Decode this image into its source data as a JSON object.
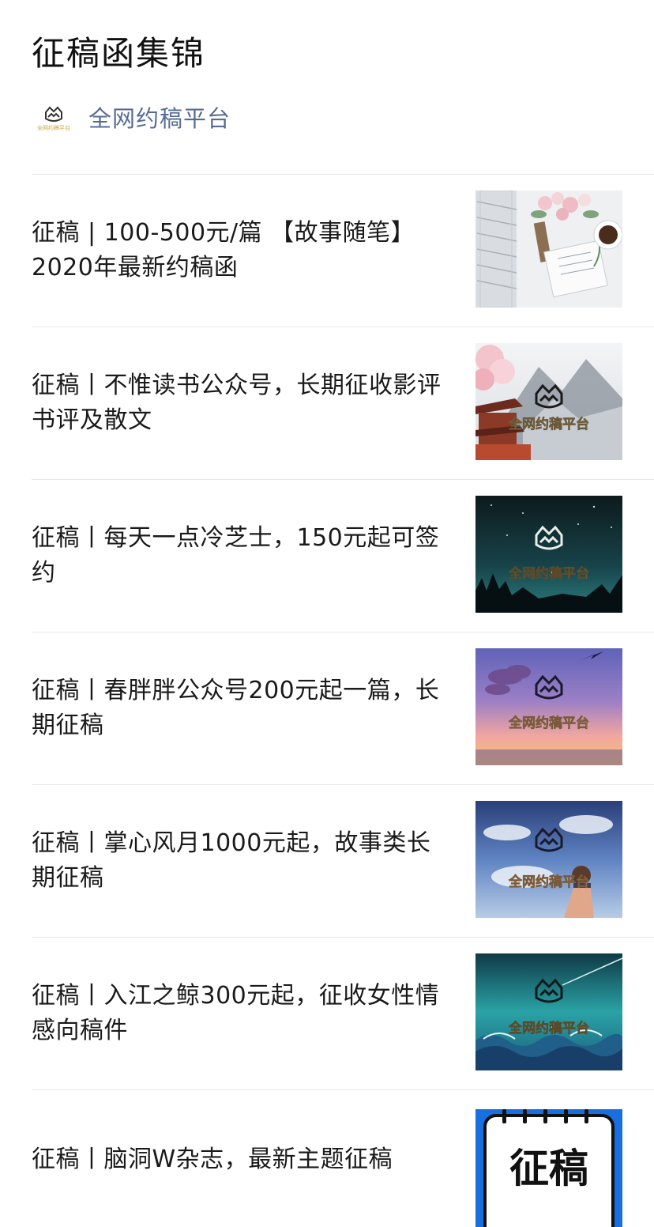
{
  "page": {
    "title": "征稿函集锦"
  },
  "account": {
    "name": "全网约稿平台",
    "logo_text": "全网约稿平台",
    "logo_icon": "crown-mountain-logo"
  },
  "articles": [
    {
      "title": "征稿 | 100-500元/篇 【故事随笔】2020年最新约稿函",
      "thumbnail": "books-flowers-coffee-photo"
    },
    {
      "title": "征稿丨不惟读书公众号，长期征收影评书评及散文",
      "thumbnail": "pavilion-mountain-painting",
      "overlay_text": "全网约稿平台"
    },
    {
      "title": "征稿丨每天一点冷芝士，150元起可签约",
      "thumbnail": "night-sky-forest",
      "overlay_text": "全网约稿平台"
    },
    {
      "title": "征稿丨春胖胖公众号200元起一篇，长期征稿",
      "thumbnail": "sunset-sky-purple",
      "overlay_text": "全网约稿平台"
    },
    {
      "title": "征稿丨掌心风月1000元起，故事类长期征稿",
      "thumbnail": "anime-girl-sky",
      "overlay_text": "全网约稿平台"
    },
    {
      "title": "征稿丨入江之鲸300元起，征收女性情感向稿件",
      "thumbnail": "teal-ocean-waves",
      "overlay_text": "全网约稿平台"
    },
    {
      "title": "征稿丨脑洞W杂志，最新主题征稿",
      "thumbnail": "calendar-zhenggao-icon",
      "overlay_text": "征稿"
    }
  ],
  "colors": {
    "account_link": "#576b95",
    "divider": "#e8e8e8",
    "calendar_border": "#1a6fe0"
  }
}
